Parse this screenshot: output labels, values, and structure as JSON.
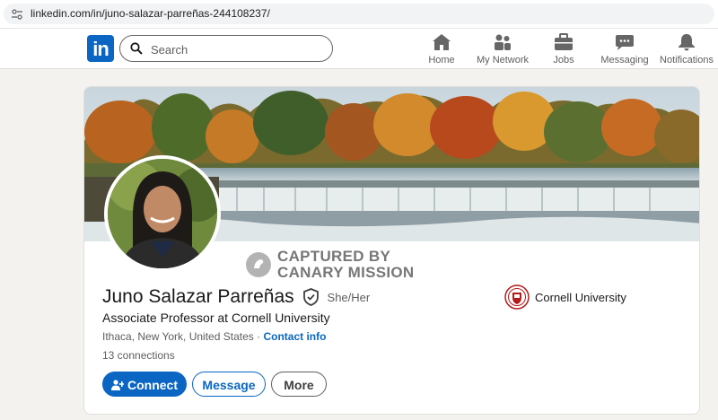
{
  "browser": {
    "url": "linkedin.com/in/juno-salazar-parreñas-244108237/"
  },
  "nav": {
    "logo_text": "in",
    "search_placeholder": "Search",
    "items": [
      {
        "label": "Home",
        "icon": "home-icon"
      },
      {
        "label": "My Network",
        "icon": "network-icon"
      },
      {
        "label": "Jobs",
        "icon": "briefcase-icon"
      },
      {
        "label": "Messaging",
        "icon": "messaging-icon"
      },
      {
        "label": "Notifications",
        "icon": "bell-icon"
      }
    ]
  },
  "watermark": {
    "line1": "CAPTURED BY",
    "line2": "CANARY MISSION"
  },
  "profile": {
    "name": "Juno Salazar Parreñas",
    "pronouns": "She/Her",
    "headline": "Associate Professor at Cornell University",
    "location": "Ithaca, New York, United States",
    "separator": "·",
    "contact_info": "Contact info",
    "connections": "13 connections",
    "education": "Cornell University"
  },
  "actions": {
    "connect": "Connect",
    "message": "Message",
    "more": "More"
  },
  "colors": {
    "brand": "#0a66c2",
    "background": "#f3f2ef",
    "text": "#191919",
    "muted": "#5e5e5e"
  }
}
